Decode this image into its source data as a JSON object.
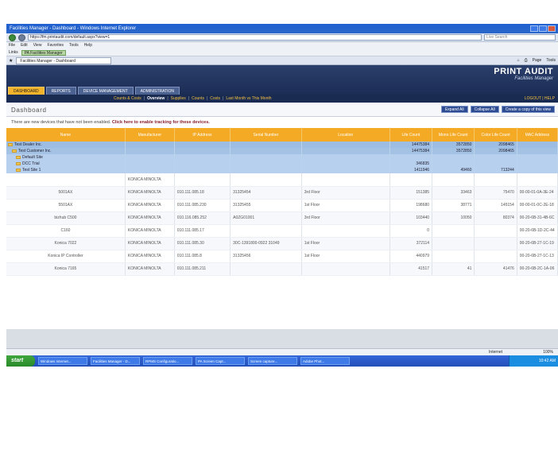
{
  "browser": {
    "title": "Facilities Manager - Dashboard - Windows Internet Explorer",
    "address": "https://fm.printaudit.com/default.aspx?view=1",
    "search_placeholder": "Live Search",
    "menu": [
      "File",
      "Edit",
      "View",
      "Favorites",
      "Tools",
      "Help"
    ],
    "links_label": "Links",
    "favorite": "PA Facilities Manager",
    "tab": "Facilities Manager - Dashboard",
    "tools": [
      "Page",
      "Tools"
    ]
  },
  "app": {
    "logo_main": "PRINT AUDIT",
    "logo_sub": "Facilities Manager",
    "nav_tabs": [
      "DASHBOARD",
      "REPORTS",
      "DEVICE MANAGEMENT",
      "ADMINISTRATION"
    ],
    "subnav_links": [
      "Counts & Costs",
      "Overview",
      "Supplies",
      "Counts",
      "Costs",
      "Last Month vs This Month"
    ],
    "subnav_right": "LOGOUT | HELP"
  },
  "dashboard": {
    "title": "Dashboard",
    "buttons": [
      "Expand All",
      "Collapse All",
      "Create a copy of this view"
    ],
    "notice_text": "There are new devices that have not been enabled.",
    "notice_link": "Click here to enable tracking for these devices."
  },
  "table": {
    "headers": [
      "Name",
      "Manufacturer",
      "IP Address",
      "Serial Number",
      "Location",
      "Life Count",
      "Mono Life Count",
      "Color Life Count",
      "MAC Address"
    ],
    "groups": [
      {
        "level": 1,
        "name": "Test Dealer Inc.",
        "life": "14475384",
        "mono": "3572850",
        "color": "2098465"
      },
      {
        "level": 2,
        "name": "Test Customer Inc.",
        "life": "14475384",
        "mono": "3572850",
        "color": "2098465"
      },
      {
        "level": 3,
        "name": "Default Site",
        "life": "",
        "mono": "",
        "color": ""
      },
      {
        "level": 3,
        "name": "DCC Trial",
        "life": "346835",
        "mono": "",
        "color": ""
      },
      {
        "level": 3,
        "name": "Test Site 1",
        "life": "1411946",
        "mono": "49460",
        "color": "713244"
      }
    ],
    "devices": [
      {
        "name": "",
        "maker": "KONICA MINOLTA",
        "ip": "",
        "serial": "",
        "loc": "",
        "life": "",
        "mono": "",
        "color": "",
        "mac": ""
      },
      {
        "name": "5001AX",
        "maker": "KONICA MINOLTA",
        "ip": "010.111.085.18",
        "serial": "31325454",
        "loc": "3rd Floor",
        "life": "151385",
        "mono": "33463",
        "color": "75470",
        "mac": "00-00-01-0A-3E-24"
      },
      {
        "name": "5501AX",
        "maker": "KONICA MINOLTA",
        "ip": "010.111.085.230",
        "serial": "31325455",
        "loc": "1st Floor",
        "life": "198680",
        "mono": "38771",
        "color": "145154",
        "mac": "00-00-01-0C-2E-18"
      },
      {
        "name": "bizhub C500",
        "maker": "KONICA MINOLTA",
        "ip": "010.116.085.252",
        "serial": "A0ZG01001",
        "loc": "3rd Floor",
        "life": "103440",
        "mono": "10050",
        "color": "80374",
        "mac": "00-20-6B-31-4B-6C"
      },
      {
        "name": "C160",
        "maker": "KONICA MINOLTA",
        "ip": "010.111.085.17",
        "serial": "",
        "loc": "",
        "life": "0",
        "mono": "",
        "color": "",
        "mac": "00-20-6B-1D-2C-44"
      },
      {
        "name": "Konica 7022",
        "maker": "KONICA MINOLTA",
        "ip": "010.111.085.30",
        "serial": "30C-1391800-0922 31049",
        "loc": "1st Floor",
        "life": "372114",
        "mono": "",
        "color": "",
        "mac": "00-20-6B-27-1C-19"
      },
      {
        "name": "Konica IP Controller",
        "maker": "KONICA MINOLTA",
        "ip": "010.111.085.8",
        "serial": "31325456",
        "loc": "1st Floor",
        "life": "440979",
        "mono": "",
        "color": "",
        "mac": "00-20-6B-27-1C-13"
      },
      {
        "name": "Konica 7165",
        "maker": "KONICA MINOLTA",
        "ip": "010.111.085.211",
        "serial": "",
        "loc": "",
        "life": "41517",
        "mono": "41",
        "color": "41476",
        "mac": "00-20-6B-2C-1A-06"
      }
    ]
  },
  "status": {
    "zone": "Internet",
    "zoom": "100%"
  },
  "taskbar": {
    "start": "start",
    "tasks": [
      "Windows Internet...",
      "Facilities Manager - D...",
      "RPMS Configuratio...",
      "PA Screen Capt...",
      "Screen capture...",
      "Adobe Phot..."
    ],
    "clock": "10:42 AM"
  },
  "colors": {
    "header_bg": "#1c2d55",
    "accent": "#f4aa25",
    "group_row": "#a4c2e4",
    "notice_link": "#8a1f2c"
  }
}
